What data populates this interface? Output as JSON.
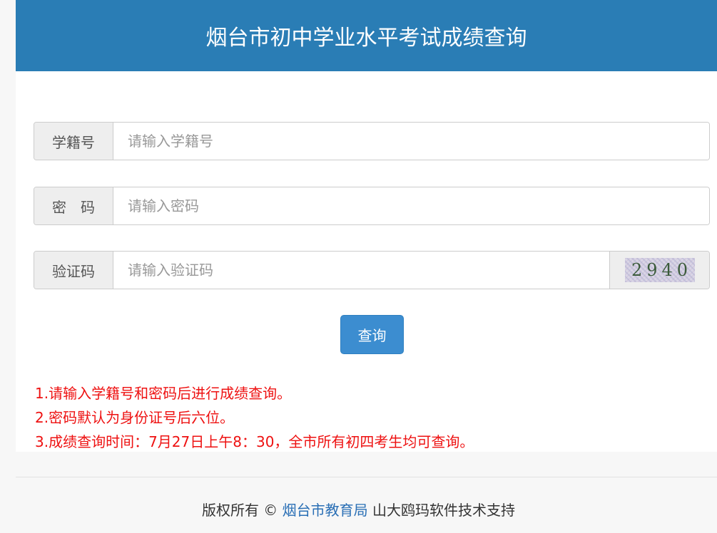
{
  "header": {
    "title": "烟台市初中学业水平考试成绩查询"
  },
  "form": {
    "student_id": {
      "label": "学籍号",
      "placeholder": "请输入学籍号",
      "value": ""
    },
    "password": {
      "label": "密　码",
      "placeholder": "请输入密码",
      "value": ""
    },
    "captcha": {
      "label": "验证码",
      "placeholder": "请输入验证码",
      "value": "",
      "image_text": "2940"
    },
    "submit_label": "查询"
  },
  "notes": [
    "1.请输入学籍号和密码后进行成绩查询。",
    "2.密码默认为身份证号后六位。",
    "3.成绩查询时间：7月27日上午8：30，全市所有初四考生均可查询。"
  ],
  "footer": {
    "prefix": "版权所有 © ",
    "link_text": "烟台市教育局",
    "suffix": " 山大鸥玛软件技术支持"
  },
  "colors": {
    "header_bg": "#2a7db5",
    "button_bg": "#3c8dd0",
    "note_text": "#ee1111",
    "link": "#2a6fb5"
  }
}
